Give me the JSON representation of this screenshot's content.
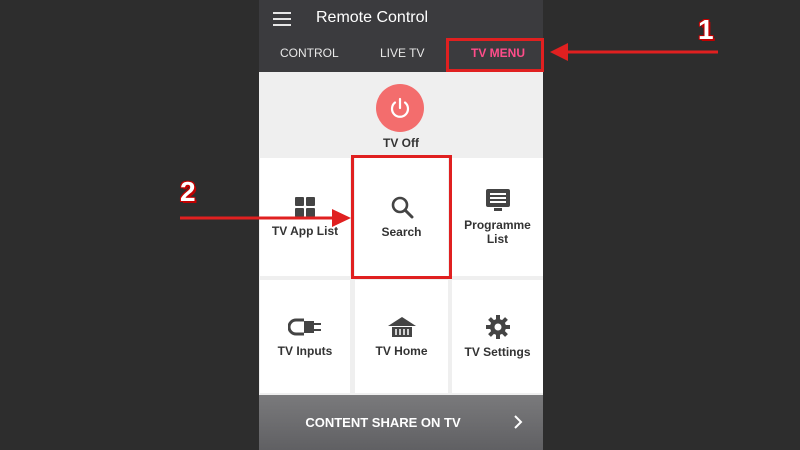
{
  "app": {
    "title": "Remote Control"
  },
  "tabs": [
    {
      "label": "CONTROL",
      "active": false
    },
    {
      "label": "LIVE TV",
      "active": false
    },
    {
      "label": "TV MENU",
      "active": true
    }
  ],
  "power": {
    "label": "TV Off",
    "color": "#f36d6d"
  },
  "grid": [
    {
      "label": "TV App List",
      "icon": "grid-icon"
    },
    {
      "label": "Search",
      "icon": "search-icon"
    },
    {
      "label": "Programme List",
      "icon": "list-icon"
    },
    {
      "label": "TV Inputs",
      "icon": "input-cable-icon"
    },
    {
      "label": "TV Home",
      "icon": "home-icon"
    },
    {
      "label": "TV Settings",
      "icon": "gear-icon"
    }
  ],
  "share": {
    "label": "CONTENT SHARE ON TV"
  },
  "annotations": {
    "step1": "1",
    "step2": "2",
    "color": "#e02020"
  },
  "accent": "#ff4d8a"
}
